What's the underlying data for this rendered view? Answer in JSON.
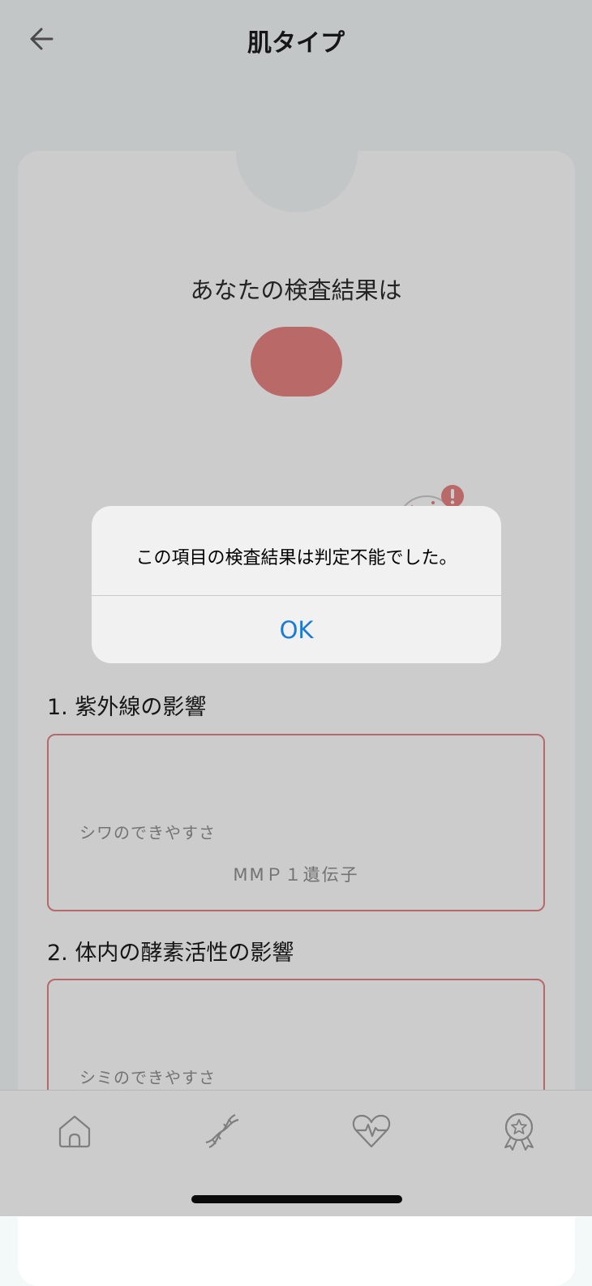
{
  "header": {
    "title": "肌タイプ",
    "back_icon": "arrow-left-icon"
  },
  "result": {
    "heading": "あなたの検査結果は",
    "pill_color": "#e87d7d"
  },
  "sections": [
    {
      "title": "1. 紫外線の影響",
      "item_label": "シワのできやすさ",
      "gene": "MMＰ１遺伝子"
    },
    {
      "title": "2. 体内の酵素活性の影響",
      "item_label": "シミのできやすさ"
    }
  ],
  "dialog": {
    "message": "この項目の検査結果は判定不能でした。",
    "ok_label": "OK"
  },
  "tabbar": {
    "items": [
      {
        "icon": "home-icon"
      },
      {
        "icon": "dna-icon"
      },
      {
        "icon": "heart-pulse-icon"
      },
      {
        "icon": "award-badge-icon"
      }
    ]
  },
  "colors": {
    "accent": "#e87d7d",
    "link": "#1a7bd6",
    "background": "#f3f8f9"
  }
}
